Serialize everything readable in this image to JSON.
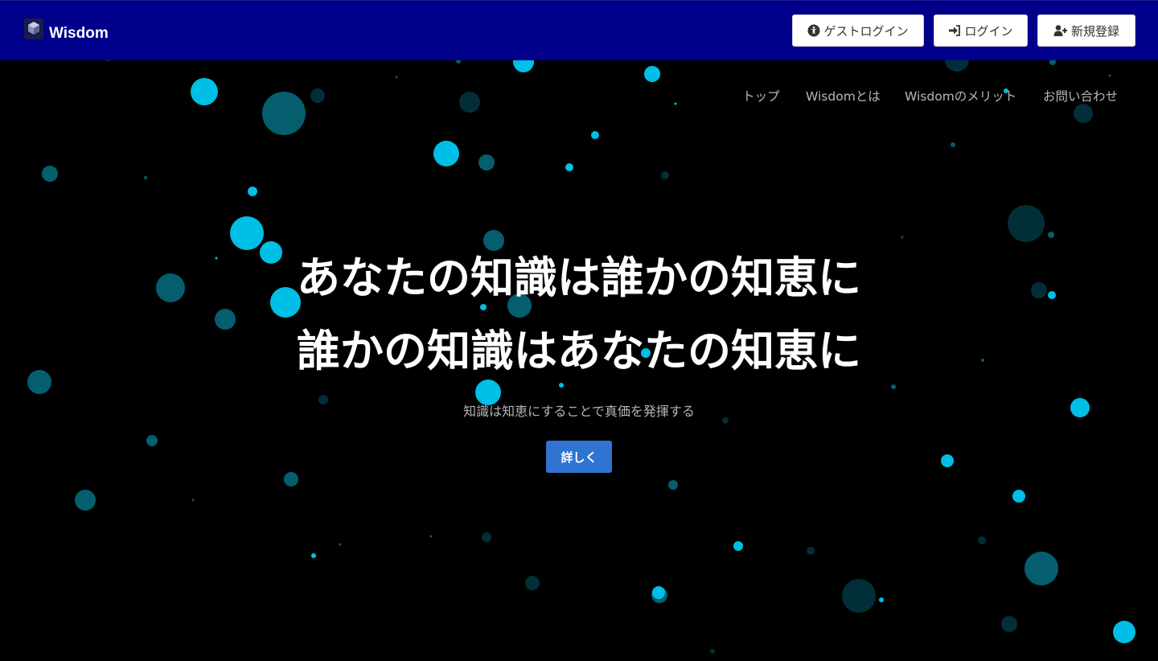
{
  "header": {
    "brand": "Wisdom",
    "buttons": {
      "guest_login": "ゲストログイン",
      "login": "ログイン",
      "signup": "新規登録"
    },
    "colors": {
      "background": "#00008b",
      "button_bg": "#ffffff"
    }
  },
  "nav": {
    "items": [
      "トップ",
      "Wisdomとは",
      "Wisdomのメリット",
      "お問い合わせ"
    ]
  },
  "hero": {
    "line1": "あなたの知識は誰かの知恵に",
    "line2": "誰かの知識はあなたの知恵に",
    "subtitle": "知識は知恵にすることで真価を発揮する",
    "cta_label": "詳しく",
    "colors": {
      "background": "#000000",
      "cta": "#2f74d0",
      "particle_bright": "#00bfe6",
      "particle_dim": "#045e6e"
    }
  },
  "icons": {
    "logo": "cube-logo-icon",
    "guest_login": "accessibility-icon",
    "login": "sign-in-icon",
    "signup": "user-plus-icon"
  }
}
